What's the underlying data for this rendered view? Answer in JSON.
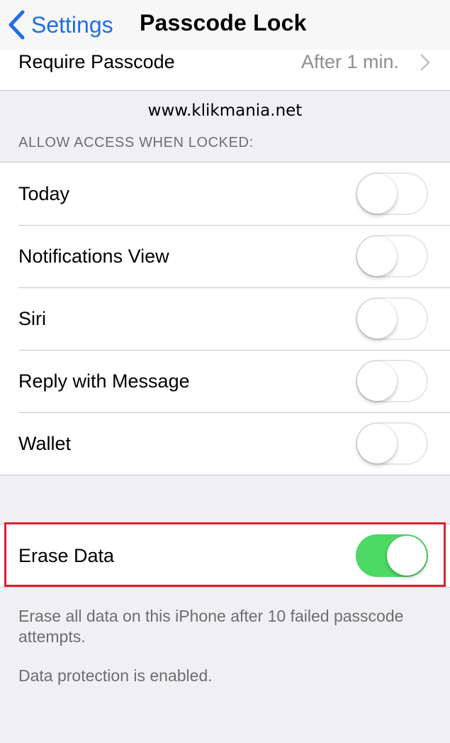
{
  "nav": {
    "back_label": "Settings",
    "title": "Passcode Lock"
  },
  "require_passcode": {
    "label": "Require Passcode",
    "value": "After 1 min."
  },
  "watermark": "www.klikmania.net",
  "section_header": "ALLOW ACCESS WHEN LOCKED:",
  "toggles": [
    {
      "label": "Today",
      "on": false
    },
    {
      "label": "Notifications View",
      "on": false
    },
    {
      "label": "Siri",
      "on": false
    },
    {
      "label": "Reply with Message",
      "on": false
    },
    {
      "label": "Wallet",
      "on": false
    }
  ],
  "erase_data": {
    "label": "Erase Data",
    "on": true
  },
  "footer": {
    "note1": "Erase all data on this iPhone after 10 failed passcode attempts.",
    "note2": "Data protection is enabled."
  },
  "colors": {
    "accent": "#1f6fe5",
    "switch_on": "#4cd964",
    "highlight": "#e0202a",
    "background": "#efeff4"
  }
}
